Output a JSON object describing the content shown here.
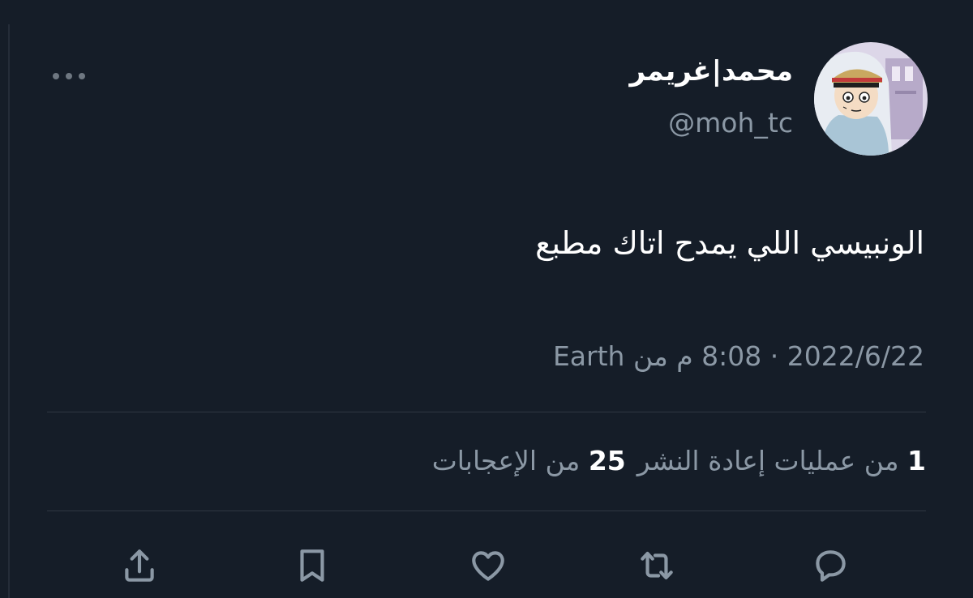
{
  "user": {
    "display_name": "محمد|غريمر",
    "handle": "@moh_tc",
    "avatar_icon": "anime-character-avatar"
  },
  "tweet": {
    "text": "الونبيسي اللي يمدح اتاك مطبع",
    "date": "2022/6/22",
    "separator": "·",
    "time": "8:08 م",
    "source_prefix": "من",
    "source": "Earth"
  },
  "stats": {
    "retweets_count": "1",
    "retweets_label": "من عمليات إعادة النشر",
    "likes_count": "25",
    "likes_label": "من الإعجابات"
  },
  "actions": {
    "icons": [
      "reply-icon",
      "retweet-icon",
      "like-icon",
      "bookmark-icon",
      "share-icon"
    ]
  },
  "colors": {
    "background": "#151d28",
    "primary_text": "#ffffff",
    "secondary_text": "#8b98a5",
    "divider": "#2f3742"
  }
}
